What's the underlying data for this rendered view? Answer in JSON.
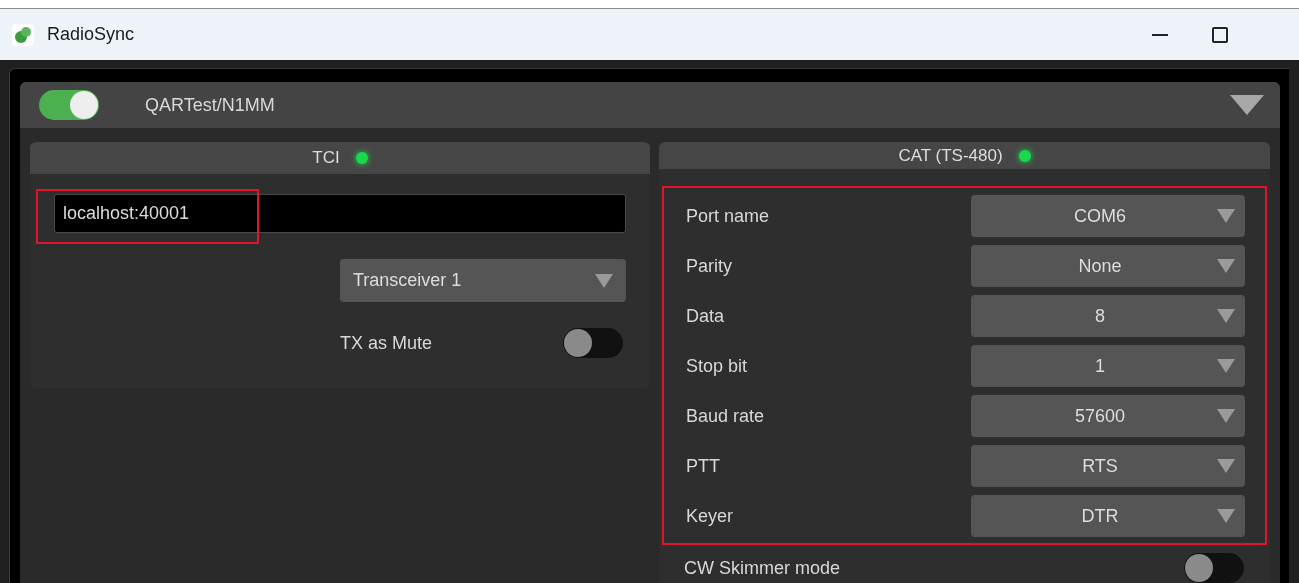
{
  "window": {
    "title": "RadioSync"
  },
  "profile": {
    "enabled": true,
    "name": "QARTest/N1MM",
    "expanded": true
  },
  "tci": {
    "title": "TCI",
    "connected": true,
    "address": "localhost:40001",
    "transceiver": "Transceiver 1",
    "tx_as_mute": {
      "label": "TX as Mute",
      "on": false
    }
  },
  "cat": {
    "title": "CAT (TS-480)",
    "connected": true,
    "settings": [
      {
        "label": "Port name",
        "value": "COM6"
      },
      {
        "label": "Parity",
        "value": "None"
      },
      {
        "label": "Data",
        "value": "8"
      },
      {
        "label": "Stop bit",
        "value": "1"
      },
      {
        "label": "Baud rate",
        "value": "57600"
      },
      {
        "label": "PTT",
        "value": "RTS"
      },
      {
        "label": "Keyer",
        "value": "DTR"
      }
    ],
    "cw_skimmer": {
      "label": "CW Skimmer mode",
      "on": false
    }
  }
}
